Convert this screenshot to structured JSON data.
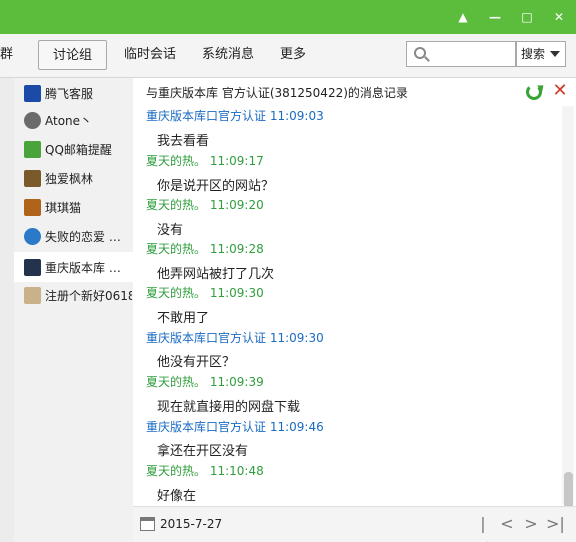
{
  "window": {
    "controls": [
      "▲",
      "—",
      "□",
      "✕"
    ]
  },
  "toolbar": {
    "tabs": [
      "群",
      "讨论组",
      "临时会话",
      "系统消息",
      "更多"
    ],
    "search_placeholder": "",
    "search_select": "搜索"
  },
  "sidebar": {
    "items": [
      {
        "label": "腾飞客服",
        "avatar_color": "#1b4aa8"
      },
      {
        "label": "Atone丶",
        "avatar_color": "#6a6a6a"
      },
      {
        "label": "QQ邮箱提醒",
        "avatar_color": "#4aa33b"
      },
      {
        "label": "独爱枫林",
        "avatar_color": "#7a5a2b"
      },
      {
        "label": "琪琪猫",
        "avatar_color": "#b0641b"
      },
      {
        "label": "失败的恋爱 …",
        "avatar_color": "#2c78c9"
      },
      {
        "label": "重庆版本库 …",
        "avatar_color": "#23324d"
      },
      {
        "label": "注册个新好0618",
        "avatar_color": "#c9b28a"
      }
    ]
  },
  "chat": {
    "header": "与重庆版本库  官方认证(381250422)的消息记录",
    "messages": [
      {
        "meta": "重庆版本库口官方认证  11:09:03",
        "color": "blue",
        "text": "我去看看"
      },
      {
        "meta": "夏天的热。 11:09:17",
        "color": "green",
        "text": "你是说开区的网站？"
      },
      {
        "meta": "夏天的热。 11:09:20",
        "color": "green",
        "text": "没有"
      },
      {
        "meta": "夏天的热。 11:09:28",
        "color": "green",
        "text": "他弄网站被打了几次"
      },
      {
        "meta": "夏天的热。 11:09:30",
        "color": "green",
        "text": "不敢用了"
      },
      {
        "meta": "重庆版本库口官方认证  11:09:30",
        "color": "blue",
        "text": "他没有开区？"
      },
      {
        "meta": "夏天的热。 11:09:39",
        "color": "green",
        "text": "现在就直接用的网盘下载"
      },
      {
        "meta": "重庆版本库口官方认证  11:09:46",
        "color": "blue",
        "text": "拿还在开区没有"
      },
      {
        "meta": "夏天的热。 11:10:48",
        "color": "green",
        "text": "好像在"
      }
    ]
  },
  "bottom": {
    "date": "2015-7-27",
    "nav": [
      "|<",
      "<",
      ">",
      ">|"
    ]
  }
}
